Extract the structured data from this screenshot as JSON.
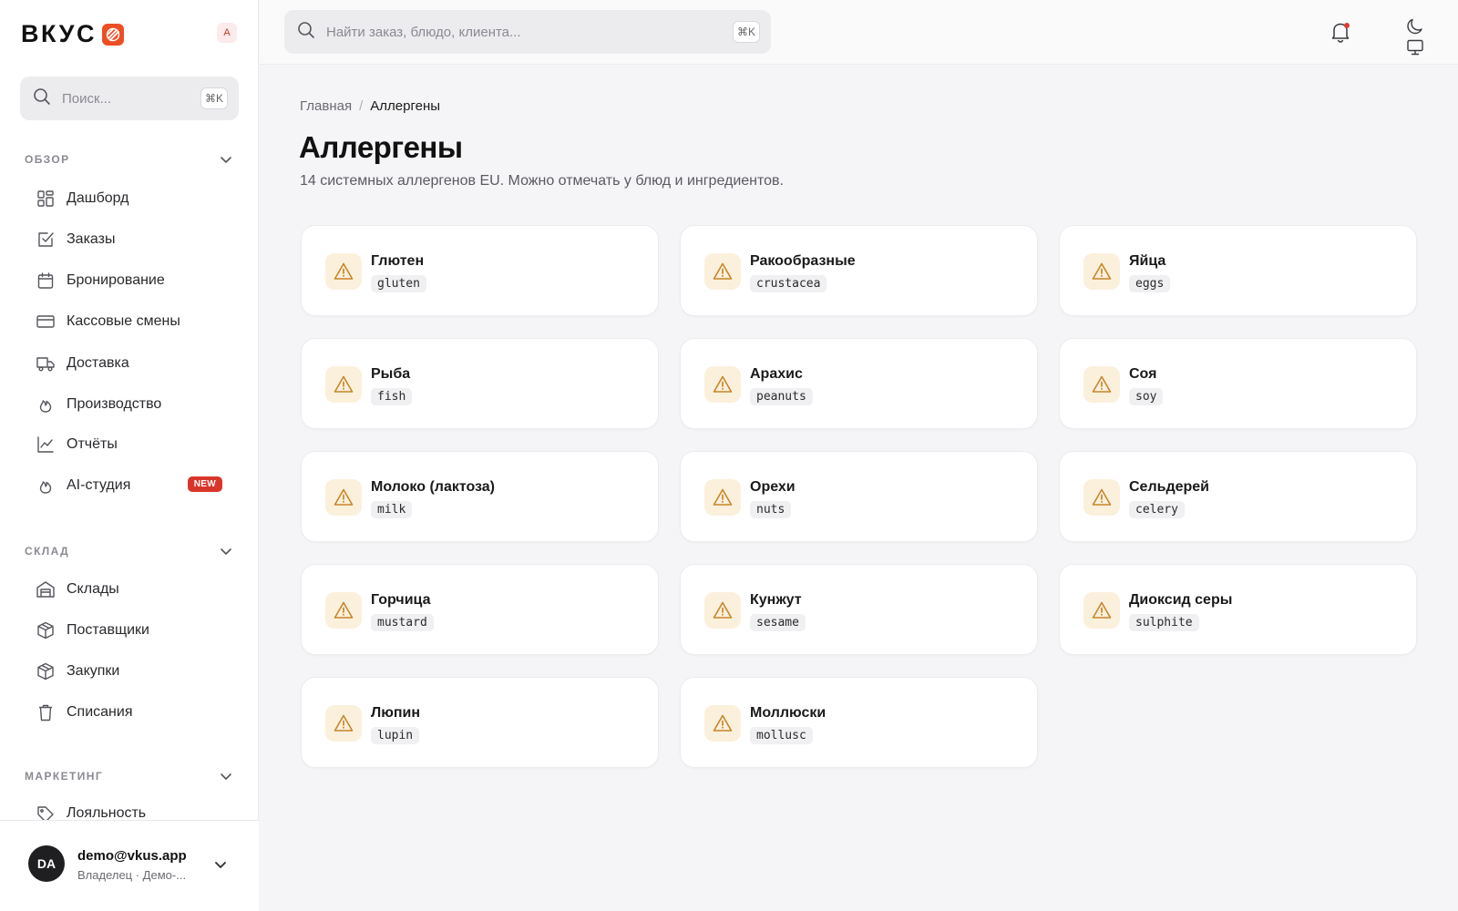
{
  "brand": {
    "name": "ВКУС",
    "workspace_badge": "A",
    "accent": "#ec4f25"
  },
  "sidebar": {
    "search": {
      "placeholder": "Поиск...",
      "shortcut": "⌘K"
    },
    "sections": [
      {
        "title": "ОБЗОР",
        "items": [
          {
            "label": "Дашборд",
            "icon": "grid-icon"
          },
          {
            "label": "Заказы",
            "icon": "check-square-icon"
          },
          {
            "label": "Бронирование",
            "icon": "calendar-icon"
          },
          {
            "label": "Кассовые смены",
            "icon": "credit-card-icon"
          },
          {
            "label": "Доставка",
            "icon": "truck-icon"
          },
          {
            "label": "Производство",
            "icon": "flame-icon"
          },
          {
            "label": "Отчёты",
            "icon": "chart-line-icon"
          },
          {
            "label": "AI-студия",
            "icon": "flame-icon",
            "badge": "NEW"
          }
        ]
      },
      {
        "title": "СКЛАД",
        "items": [
          {
            "label": "Склады",
            "icon": "warehouse-icon"
          },
          {
            "label": "Поставщики",
            "icon": "package-icon"
          },
          {
            "label": "Закупки",
            "icon": "package-icon"
          },
          {
            "label": "Списания",
            "icon": "trash-icon"
          }
        ]
      },
      {
        "title": "МАРКЕТИНГ",
        "items": [
          {
            "label": "Лояльность",
            "icon": "tag-icon"
          }
        ]
      }
    ],
    "user": {
      "initials": "DA",
      "email": "demo@vkus.app",
      "role": "Владелец · Демо-..."
    }
  },
  "topbar": {
    "search": {
      "placeholder": "Найти заказ, блюдо, клиента...",
      "shortcut": "⌘K"
    },
    "icons": [
      "bell-icon",
      "moon-icon",
      "monitor-icon"
    ]
  },
  "main": {
    "breadcrumb": {
      "home": "Главная",
      "separator": "/",
      "current": "Аллергены"
    },
    "title": "Аллергены",
    "subtitle": "14 системных аллергенов EU. Можно отмечать у блюд и ингредиентов.",
    "allergens": [
      {
        "name": "Глютен",
        "code": "gluten"
      },
      {
        "name": "Ракообразные",
        "code": "crustacea"
      },
      {
        "name": "Яйца",
        "code": "eggs"
      },
      {
        "name": "Рыба",
        "code": "fish"
      },
      {
        "name": "Арахис",
        "code": "peanuts"
      },
      {
        "name": "Соя",
        "code": "soy"
      },
      {
        "name": "Молоко (лактоза)",
        "code": "milk"
      },
      {
        "name": "Орехи",
        "code": "nuts"
      },
      {
        "name": "Сельдерей",
        "code": "celery"
      },
      {
        "name": "Горчица",
        "code": "mustard"
      },
      {
        "name": "Кунжут",
        "code": "sesame"
      },
      {
        "name": "Диоксид серы",
        "code": "sulphite"
      },
      {
        "name": "Люпин",
        "code": "lupin"
      },
      {
        "name": "Моллюски",
        "code": "mollusc"
      }
    ]
  }
}
